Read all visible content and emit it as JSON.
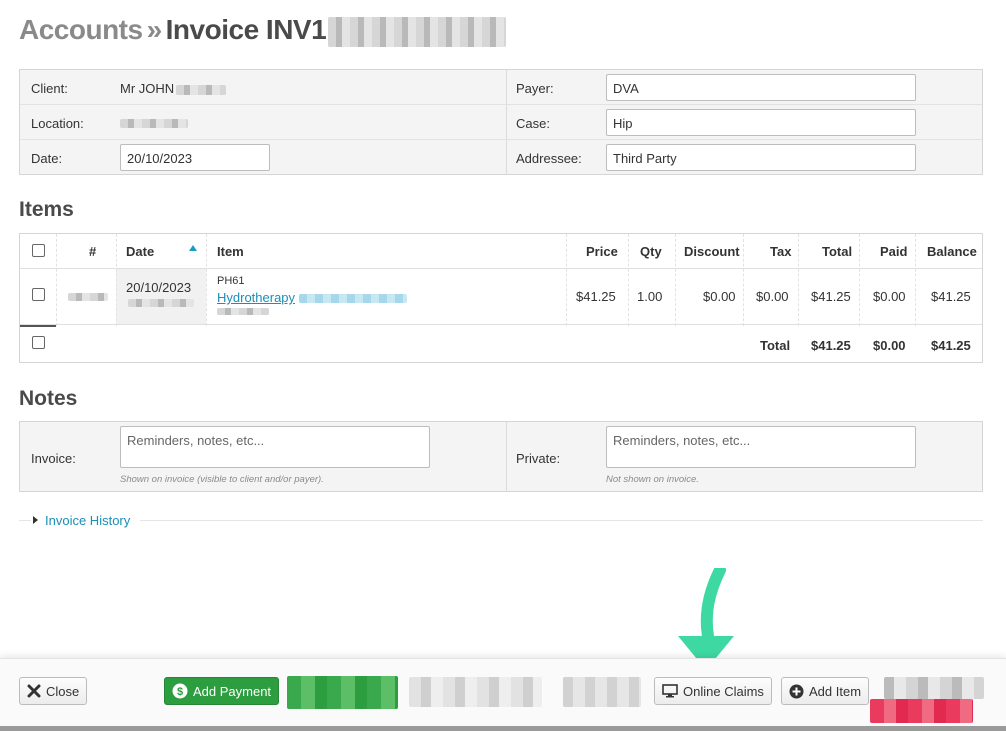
{
  "header": {
    "crumb": "Accounts",
    "separator": "»",
    "title": "Invoice INV1"
  },
  "details": {
    "client_label": "Client:",
    "client_value": "Mr JOHN",
    "location_label": "Location:",
    "date_label": "Date:",
    "date_value": "20/10/2023",
    "payer_label": "Payer:",
    "payer_value": "DVA",
    "case_label": "Case:",
    "case_value": "Hip",
    "addressee_label": "Addressee:",
    "addressee_value": "Third Party"
  },
  "items": {
    "title": "Items",
    "columns": [
      "#",
      "Date",
      "Item",
      "Price",
      "Qty",
      "Discount",
      "Tax",
      "Total",
      "Paid",
      "Balance"
    ],
    "rows": [
      {
        "date": "20/10/2023",
        "code": "PH61",
        "item": "Hydrotherapy",
        "price": "$41.25",
        "qty": "1.00",
        "discount": "$0.00",
        "tax": "$0.00",
        "total": "$41.25",
        "paid": "$0.00",
        "balance": "$41.25"
      }
    ],
    "totals": {
      "label": "Total",
      "total": "$41.25",
      "paid": "$0.00",
      "balance": "$41.25"
    }
  },
  "notes": {
    "title": "Notes",
    "invoice_label": "Invoice:",
    "invoice_placeholder": "Reminders, notes, etc...",
    "invoice_hint": "Shown on invoice (visible to client and/or payer).",
    "private_label": "Private:",
    "private_placeholder": "Reminders, notes, etc...",
    "private_hint": "Not shown on invoice."
  },
  "history": {
    "label": "Invoice History"
  },
  "footer": {
    "close": "Close",
    "add_payment": "Add Payment",
    "online_claims": "Online Claims",
    "add_item": "Add Item"
  },
  "colors": {
    "link": "#1a8fb8",
    "green": "#2c9e3f",
    "balance_red": "#d9363e",
    "arrow": "#3ed9a3"
  }
}
